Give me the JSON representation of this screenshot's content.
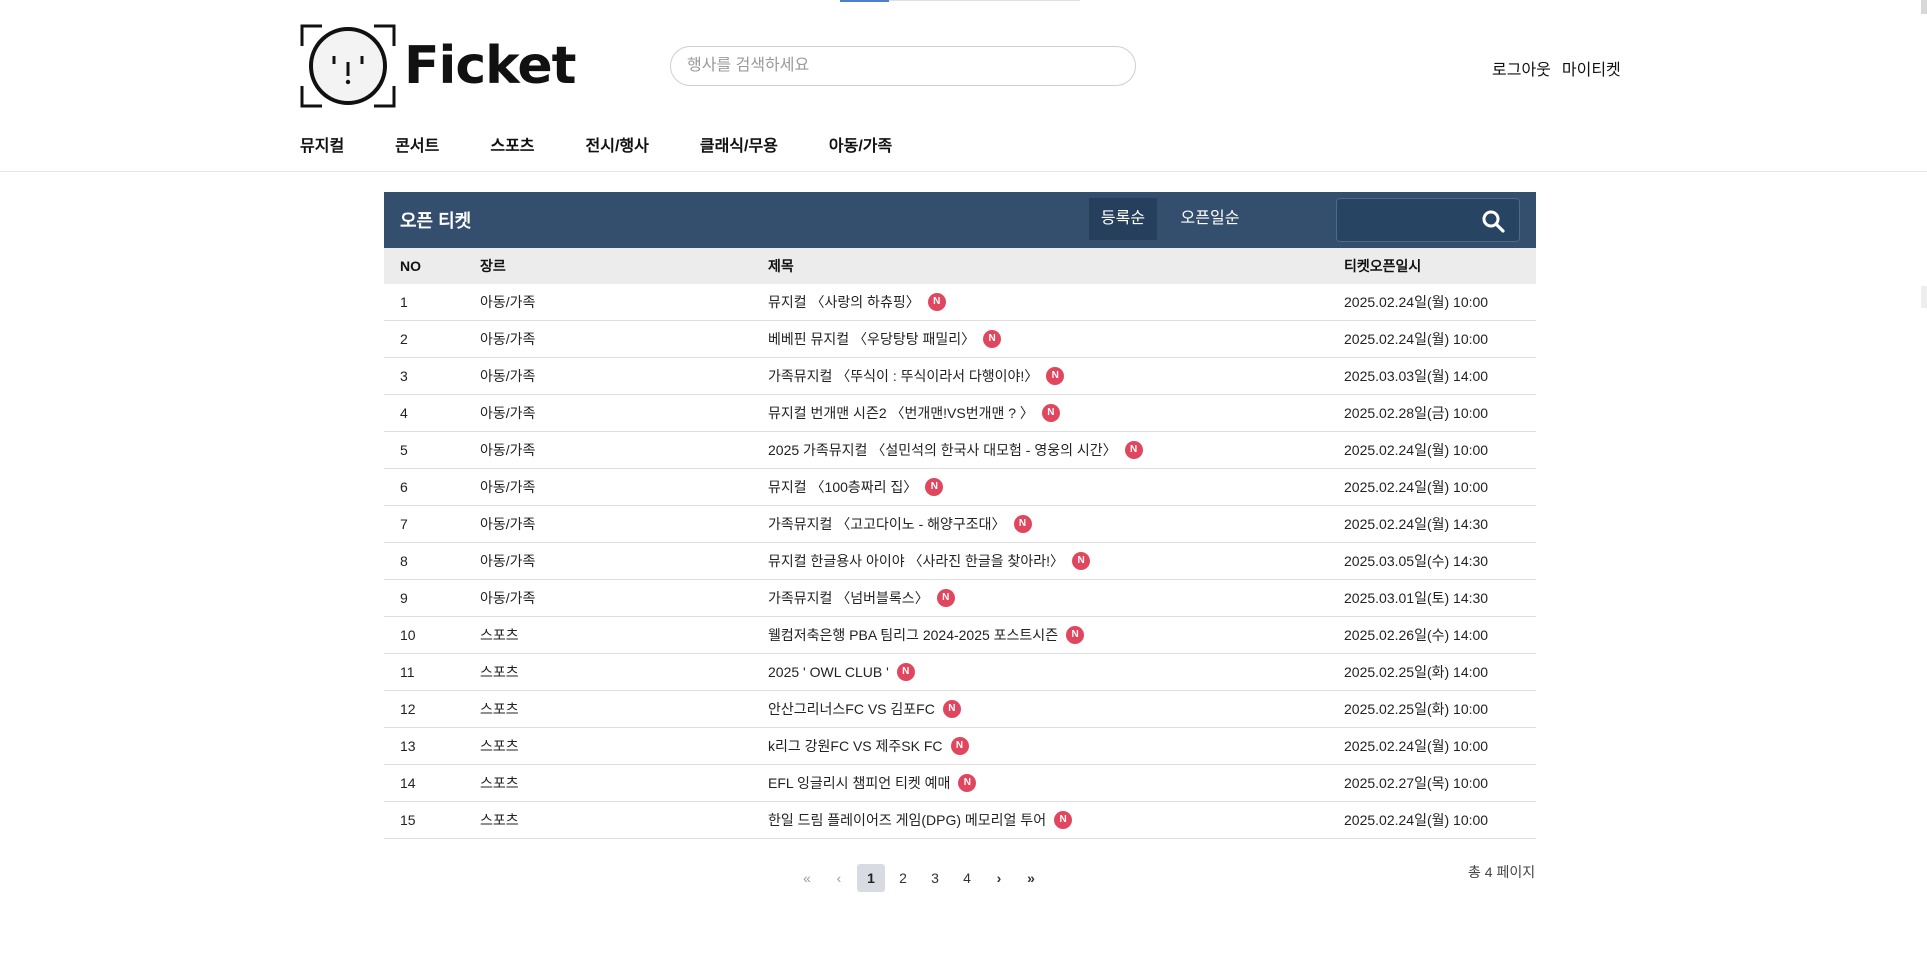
{
  "header": {
    "brand": "Ficket",
    "search_placeholder": "행사를 검색하세요",
    "logout": "로그아웃",
    "my_ticket": "마이티켓"
  },
  "nav": [
    "뮤지컬",
    "콘서트",
    "스포츠",
    "전시/행사",
    "클래식/무용",
    "아동/가족"
  ],
  "board": {
    "title": "오픈 티켓",
    "sort_options": [
      "등록순",
      "오픈일순"
    ],
    "columns": [
      "NO",
      "장르",
      "제목",
      "티켓오픈일시"
    ],
    "badge": "N",
    "rows": [
      {
        "no": "1",
        "genre": "아동/가족",
        "title": "뮤지컬 〈사랑의 하츄핑〉",
        "date": "2025.02.24일(월) 10:00"
      },
      {
        "no": "2",
        "genre": "아동/가족",
        "title": "베베핀 뮤지컬 〈우당탕탕 패밀리〉",
        "date": "2025.02.24일(월) 10:00"
      },
      {
        "no": "3",
        "genre": "아동/가족",
        "title": "가족뮤지컬 〈뚜식이 : 뚜식이라서 다행이야!〉",
        "date": "2025.03.03일(월) 14:00"
      },
      {
        "no": "4",
        "genre": "아동/가족",
        "title": "뮤지컬 번개맨 시즌2 〈번개맨!VS번개맨 ? 〉",
        "date": "2025.02.28일(금) 10:00"
      },
      {
        "no": "5",
        "genre": "아동/가족",
        "title": "2025 가족뮤지컬 〈설민석의 한국사 대모험 - 영웅의 시간〉",
        "date": "2025.02.24일(월) 10:00"
      },
      {
        "no": "6",
        "genre": "아동/가족",
        "title": "뮤지컬 〈100층짜리 집〉",
        "date": "2025.02.24일(월) 10:00"
      },
      {
        "no": "7",
        "genre": "아동/가족",
        "title": "가족뮤지컬 〈고고다이노 - 해양구조대〉",
        "date": "2025.02.24일(월) 14:30"
      },
      {
        "no": "8",
        "genre": "아동/가족",
        "title": "뮤지컬 한글용사 아이야 〈사라진 한글을 찾아라!〉",
        "date": "2025.03.05일(수) 14:30"
      },
      {
        "no": "9",
        "genre": "아동/가족",
        "title": "가족뮤지컬 〈넘버블록스〉",
        "date": "2025.03.01일(토) 14:30"
      },
      {
        "no": "10",
        "genre": "스포츠",
        "title": "웰컴저축은행 PBA 팀리그 2024-2025 포스트시즌",
        "date": "2025.02.26일(수) 14:00"
      },
      {
        "no": "11",
        "genre": "스포츠",
        "title": "2025 ' OWL CLUB '",
        "date": "2025.02.25일(화) 14:00"
      },
      {
        "no": "12",
        "genre": "스포츠",
        "title": "안산그리너스FC VS 김포FC",
        "date": "2025.02.25일(화) 10:00"
      },
      {
        "no": "13",
        "genre": "스포츠",
        "title": "k리그 강원FC VS 제주SK FC",
        "date": "2025.02.24일(월) 10:00"
      },
      {
        "no": "14",
        "genre": "스포츠",
        "title": "EFL 잉글리시 챔피언 티켓 예매",
        "date": "2025.02.27일(목) 10:00"
      },
      {
        "no": "15",
        "genre": "스포츠",
        "title": "한일 드림 플레이어즈 게임(DPG) 메모리얼 투어",
        "date": "2025.02.24일(월) 10:00"
      }
    ]
  },
  "pagination": {
    "first": "«",
    "prev": "‹",
    "pages": [
      "1",
      "2",
      "3",
      "4"
    ],
    "current": "1",
    "next": "›",
    "last": "»",
    "total_text": "총 4 페이지"
  },
  "colors": {
    "board_header": "#344f6e",
    "sort_active": "#253f5c",
    "badge": "#e0475f",
    "table_head": "#ececec"
  },
  "icons": [
    "face-logo-icon",
    "search-icon",
    "double-chevron-left-icon",
    "chevron-left-icon",
    "chevron-right-icon",
    "double-chevron-right-icon"
  ]
}
